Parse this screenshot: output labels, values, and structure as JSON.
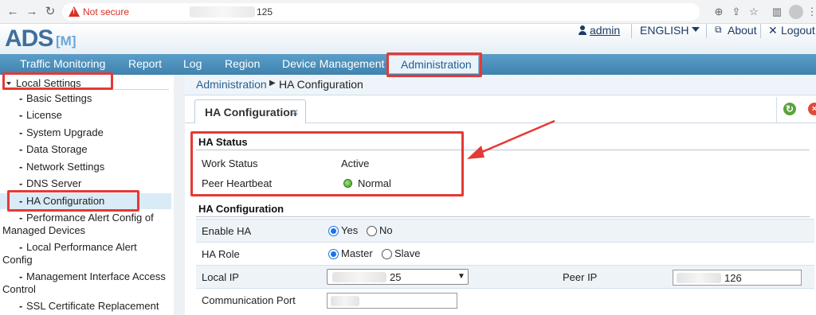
{
  "browser": {
    "not_secure": "Not secure",
    "url_suffix": "125",
    "icons": [
      "back-icon",
      "forward-icon",
      "reload-icon",
      "zoom-icon",
      "share-icon",
      "star-icon",
      "sidebar-icon",
      "profile-icon",
      "menu-icon"
    ]
  },
  "header": {
    "logo": "ADS",
    "logo_suffix": "[M]",
    "user": "admin",
    "language": "ENGLISH",
    "about": "About",
    "logout": "Logout"
  },
  "nav": {
    "items": [
      "Traffic Monitoring",
      "Report",
      "Log",
      "Region",
      "Device Management",
      "Administration"
    ],
    "active": "Administration"
  },
  "sidebar": {
    "group": "Local Settings",
    "items": [
      "Basic Settings",
      "License",
      "System Upgrade",
      "Data Storage",
      "Network Settings",
      "DNS Server",
      "HA Configuration",
      "Performance Alert Config of Managed Devices",
      "Local Performance Alert Config",
      "Management Interface Access Control",
      "SSL Certificate Replacement"
    ],
    "selected": "HA Configuration"
  },
  "breadcrumb": {
    "parent": "Administration",
    "current": "HA Configuration"
  },
  "tab": {
    "label": "HA Configuration",
    "close": "×"
  },
  "ha_status": {
    "title": "HA Status",
    "work_status_label": "Work Status",
    "work_status_value": "Active",
    "peer_heartbeat_label": "Peer Heartbeat",
    "peer_heartbeat_value": "Normal"
  },
  "ha_config": {
    "title": "HA Configuration",
    "enable_label": "Enable HA",
    "yes": "Yes",
    "no": "No",
    "enable_value": "Yes",
    "role_label": "HA Role",
    "master": "Master",
    "slave": "Slave",
    "role_value": "Master",
    "local_ip_label": "Local IP",
    "local_ip_suffix": "25",
    "peer_ip_label": "Peer IP",
    "peer_ip_suffix": "126",
    "comm_port_label": "Communication Port"
  },
  "colors": {
    "highlight": "#e53935",
    "nav": "#4a8fbb",
    "status_ok": "#3d9b24"
  }
}
